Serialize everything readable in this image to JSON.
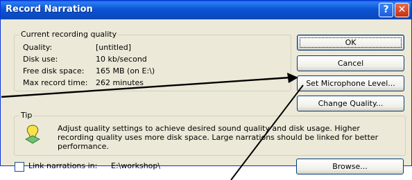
{
  "window": {
    "title": "Record Narration"
  },
  "quality": {
    "legend": "Current recording quality",
    "rows": [
      {
        "label": "Quality:",
        "value": "[untitled]"
      },
      {
        "label": "Disk use:",
        "value": "10 kb/second"
      },
      {
        "label": "Free disk space:",
        "value": "165 MB (on E:\\)"
      },
      {
        "label": "Max record time:",
        "value": "262 minutes"
      }
    ]
  },
  "buttons": {
    "ok": "OK",
    "cancel": "Cancel",
    "mic": "Set Microphone Level...",
    "change_quality": "Change Quality...",
    "browse": "Browse..."
  },
  "tip": {
    "legend": "Tip",
    "lines": [
      "Adjust quality settings to achieve desired sound quality and disk usage. Higher",
      "recording quality uses more disk space. Large narrations should be linked for better",
      "performance."
    ]
  },
  "link": {
    "label": "Link narrations in:",
    "path": "E:\\workshop\\",
    "checked": false
  },
  "icons": {
    "tip": "lightbulb-icon",
    "help": "help-icon",
    "close": "close-icon"
  },
  "colors": {
    "titlebar": "#0a55d6",
    "dialog": "#ece9d8",
    "arrow": "#000000"
  }
}
